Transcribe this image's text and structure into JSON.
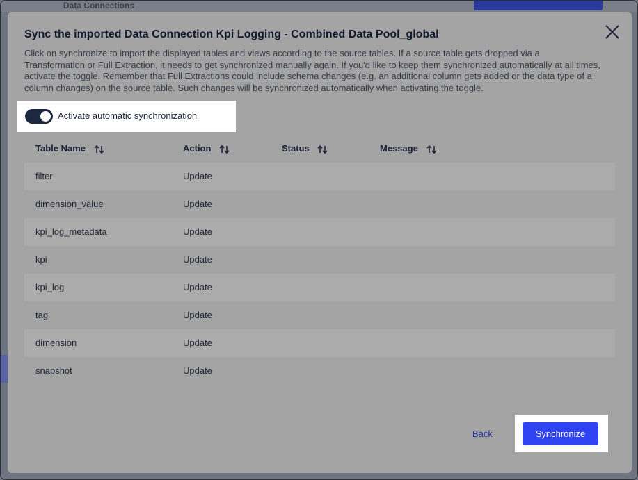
{
  "background": {
    "breadcrumb_text": "Data Connections",
    "accent_color": "#2a3a9c"
  },
  "modal": {
    "title": "Sync the imported Data Connection Kpi Logging - Combined Data Pool_global",
    "description": "Click on synchronize to import the displayed tables and views according to the source tables. If a source table gets dropped via a Transformation or Full Extraction, it needs to get synchronized manually again. If you'd like to keep them synchronized automatically at all times, activate the toggle. Remember that Full Extractions could include schema changes (e.g. an additional column gets added or the data type of a column changes) on the source table. Such changes will be synchronized automatically when activating the toggle.",
    "close_icon": "close-icon"
  },
  "toggle": {
    "label": "Activate automatic synchronization",
    "state": "on"
  },
  "table": {
    "columns": [
      "Table Name",
      "Action",
      "Status",
      "Message"
    ],
    "sort_icon": "sort-icon",
    "rows": [
      {
        "name": "filter",
        "action": "Update",
        "status": "",
        "message": ""
      },
      {
        "name": "dimension_value",
        "action": "Update",
        "status": "",
        "message": ""
      },
      {
        "name": "kpi_log_metadata",
        "action": "Update",
        "status": "",
        "message": ""
      },
      {
        "name": "kpi",
        "action": "Update",
        "status": "",
        "message": ""
      },
      {
        "name": "kpi_log",
        "action": "Update",
        "status": "",
        "message": ""
      },
      {
        "name": "tag",
        "action": "Update",
        "status": "",
        "message": ""
      },
      {
        "name": "dimension",
        "action": "Update",
        "status": "",
        "message": ""
      },
      {
        "name": "snapshot",
        "action": "Update",
        "status": "",
        "message": ""
      }
    ]
  },
  "footer": {
    "back_label": "Back",
    "synchronize_label": "Synchronize",
    "primary_color": "#2f43f3"
  }
}
